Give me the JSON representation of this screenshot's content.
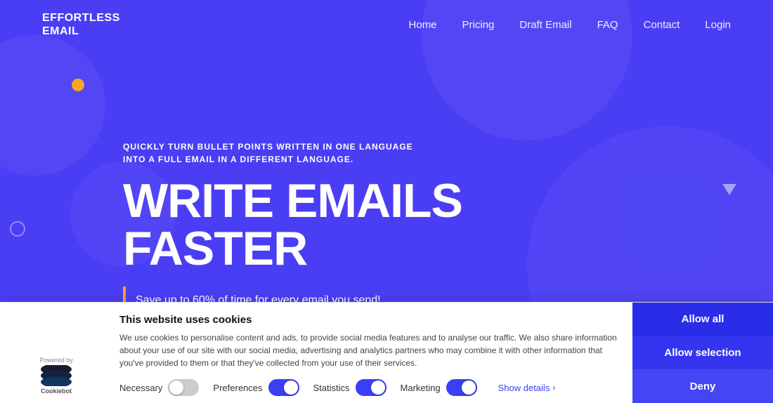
{
  "navbar": {
    "logo_line1": "EFFORTLESS",
    "logo_line2": "EMAIL",
    "links": [
      {
        "label": "Home",
        "id": "home"
      },
      {
        "label": "Pricing",
        "id": "pricing"
      },
      {
        "label": "Draft Email",
        "id": "draft-email"
      },
      {
        "label": "FAQ",
        "id": "faq"
      },
      {
        "label": "Contact",
        "id": "contact"
      },
      {
        "label": "Login",
        "id": "login"
      }
    ]
  },
  "hero": {
    "subtitle": "QUICKLY TURN BULLET POINTS WRITTEN IN ONE LANGUAGE INTO A FULL EMAIL IN A DIFFERENT LANGUAGE.",
    "title_line1": "WRITE EMAILS",
    "title_line2": "FASTER",
    "cta": "Save up to 60% of time for every email you send!"
  },
  "cookie_banner": {
    "title": "This website uses cookies",
    "body": "We use cookies to personalise content and ads, to provide social media features and to analyse our traffic. We also share information about your use of our site with our social media, advertising and analytics partners who may combine it with other information that you've provided to them or that they've collected from your use of their services.",
    "powered_by": "Powered by",
    "cookiebot_label": "Cookiebot",
    "toggles": [
      {
        "label": "Necessary",
        "state": "off",
        "id": "necessary"
      },
      {
        "label": "Preferences",
        "state": "on",
        "id": "preferences"
      },
      {
        "label": "Statistics",
        "state": "on",
        "id": "statistics"
      },
      {
        "label": "Marketing",
        "state": "on",
        "id": "marketing"
      }
    ],
    "show_details": "Show details",
    "buttons": {
      "allow_all": "Allow all",
      "allow_selection": "Allow selection",
      "deny": "Deny"
    }
  }
}
